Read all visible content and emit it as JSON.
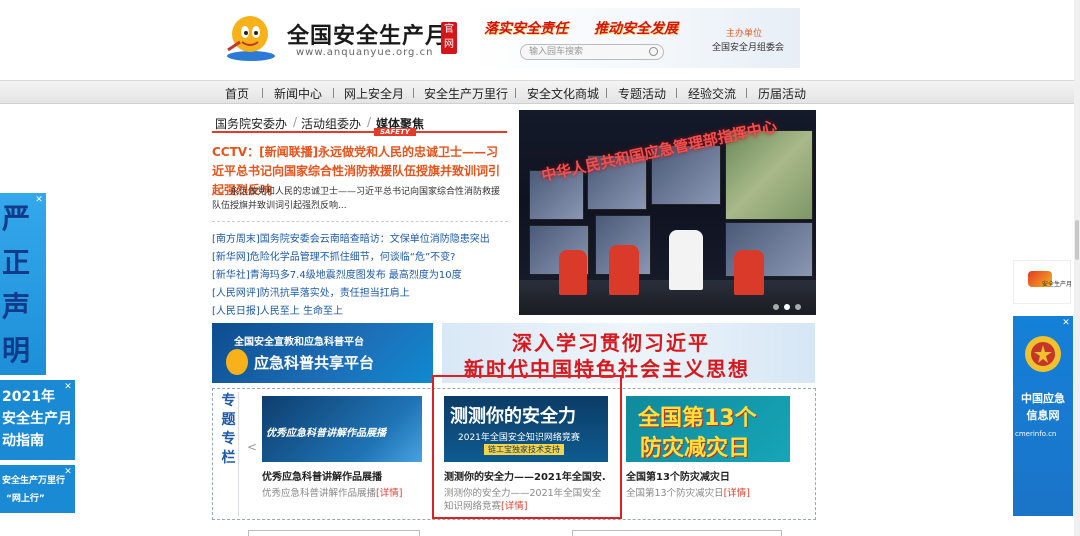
{
  "header": {
    "site_title": "全国安全生产月",
    "official_badge": "官网",
    "url": "www.anquanyue.org.cn",
    "slogan_1": "落实安全责任",
    "slogan_2": "推动安全发展",
    "search_placeholder": "输入园车搜索",
    "host_label": "主办单位",
    "host_name": "全国安全月组委会"
  },
  "nav": {
    "items": [
      "首页",
      "新闻中心",
      "网上安全月",
      "安全生产万里行",
      "安全文化商城",
      "专题活动",
      "经验交流",
      "历届活动"
    ]
  },
  "news_tabs": {
    "items": [
      "国务院安委办",
      "活动组委办",
      "媒体聚焦"
    ],
    "safety_badge": "SAFETY"
  },
  "headline": {
    "title": "CCTV：[新闻联播]永远做党和人民的忠诚卫士——习近平总书记向国家综合性消防救援队伍授旗并致训词引起强烈反响",
    "summary": "永远做党和人民的忠诚卫士——习近平总书记向国家综合性消防救援队伍授旗并致训词引起强烈反响..."
  },
  "news_list": [
    "[南方周末]国务院安委会云南暗查暗访：文保单位消防隐患突出",
    "[新华网]危险化学品管理不抓住细节，何谈临“危”不变?",
    "[新华社]青海玛多7.4级地震烈度图发布 最高烈度为10度",
    "[人民网评]防汛抗旱落实处，责任担当扛肩上",
    "[人民日报]人民至上 生命至上"
  ],
  "photo": {
    "wall_text": "中华人民共和国应急管理部指挥中心"
  },
  "banners": {
    "platform_line1": "全国安全宣教和应急科普平台",
    "platform_line2": "应急科普共享平台",
    "study_line1": "深入学习贯彻习近平",
    "study_line2": "新时代中国特色社会主义思想"
  },
  "special": {
    "label_chars": [
      "专",
      "题",
      "专",
      "栏"
    ],
    "prev_arrow": "<",
    "cards": [
      {
        "img_text": "优秀应急科普讲解作品展播",
        "title": "优秀应急科普讲解作品展播",
        "desc": "优秀应急科普讲解作品展播",
        "more": "[详情]"
      },
      {
        "img_title": "测测你的安全力",
        "img_subtitle": "2021年全国安全知识网络竞赛",
        "img_support": "链工宝独家技术支持",
        "title": "测测你的安全力——2021年全国安...",
        "desc": "测测你的安全力——2021年全国安全知识网络竞赛",
        "more": "[详情]"
      },
      {
        "img_line1": "全国第13个",
        "img_line2": "防灾减灾日",
        "title": "全国第13个防灾减灾日",
        "desc": "全国第13个防灾减灾日",
        "more": "[详情]"
      }
    ]
  },
  "float_left": {
    "chars": [
      "严",
      "正",
      "声",
      "明"
    ],
    "ad2_year": "2021年",
    "ad2_line1": "安全生产月",
    "ad2_line2": "动指南",
    "ad3_line1": "安全生产万里行",
    "ad3_line2": "“网上行”",
    "close": "✕"
  },
  "float_right": {
    "logo_text": "安全生产月",
    "ad_title": "中国应急信息网",
    "ad_url": "cmerinfo.cn"
  },
  "colors": {
    "accent_red": "#e23b2a",
    "link_blue": "#1e5aa8",
    "headline_orange": "#e8531b"
  }
}
